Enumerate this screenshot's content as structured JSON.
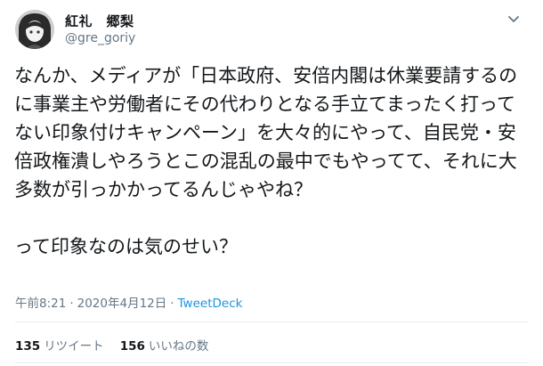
{
  "author": {
    "display_name": "紅礼　郷梨",
    "handle": "@gre_goriy"
  },
  "tweet": {
    "text": "なんか、メディアが「日本政府、安倍内閣は休業要請するのに事業主や労働者にその代わりとなる手立てまったく打ってない印象付けキャンペーン」を大々的にやって、自民党・安倍政権潰しやろうとこの混乱の最中でもやってて、それに大多数が引っかかってるんじゃやね？\n\nって印象なのは気のせい？",
    "time": "午前8:21",
    "separator": "·",
    "date": "2020年4月12日",
    "source": "TweetDeck"
  },
  "stats": {
    "retweets_count": "135",
    "retweets_label": "リツイート",
    "likes_count": "156",
    "likes_label": "いいねの数"
  },
  "colors": {
    "text": "#14171a",
    "secondary": "#657786",
    "link": "#1b95e0",
    "divider": "#e6ecf0"
  },
  "icons": {
    "avatar": "anime-character-avatar",
    "caret": "chevron-down-icon"
  }
}
